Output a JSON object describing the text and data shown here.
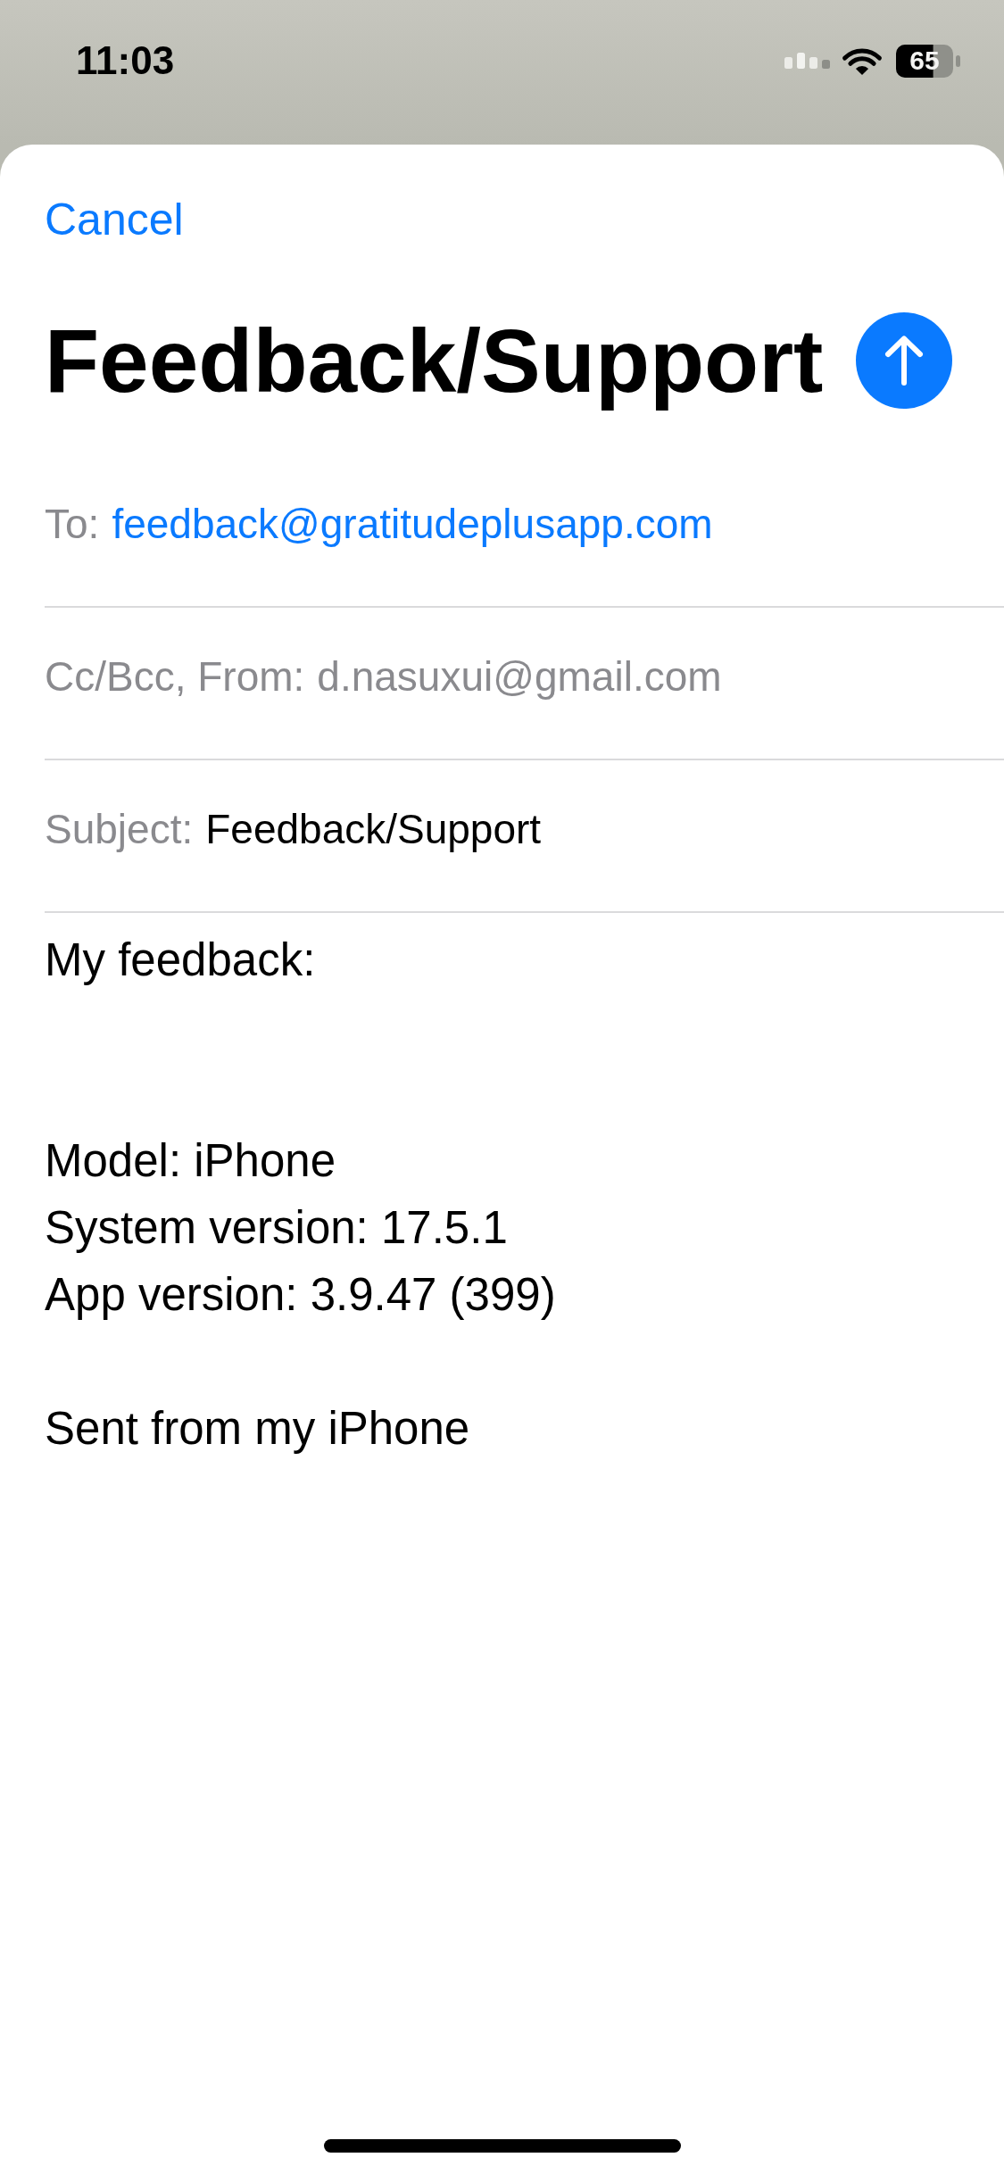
{
  "status_bar": {
    "time": "11:03",
    "battery_percent": "65"
  },
  "compose": {
    "cancel": "Cancel",
    "title": "Feedback/Support",
    "fields": [
      {
        "kind": "recipient",
        "label": "To:",
        "value": "feedback@gratitudeplusapp.com"
      },
      {
        "kind": "sender",
        "label": "Cc/Bcc, From:",
        "value": "d.nasuxui@gmail.com"
      },
      {
        "kind": "subject",
        "label": "Subject:",
        "value": "Feedback/Support"
      }
    ],
    "body": [
      {
        "lines": [
          "My feedback:"
        ]
      },
      {
        "lines": [
          "Model: iPhone",
          "System version: 17.5.1",
          "App version: 3.9.47 (399)"
        ]
      },
      {
        "lines": [
          "Sent from my iPhone"
        ]
      }
    ]
  }
}
